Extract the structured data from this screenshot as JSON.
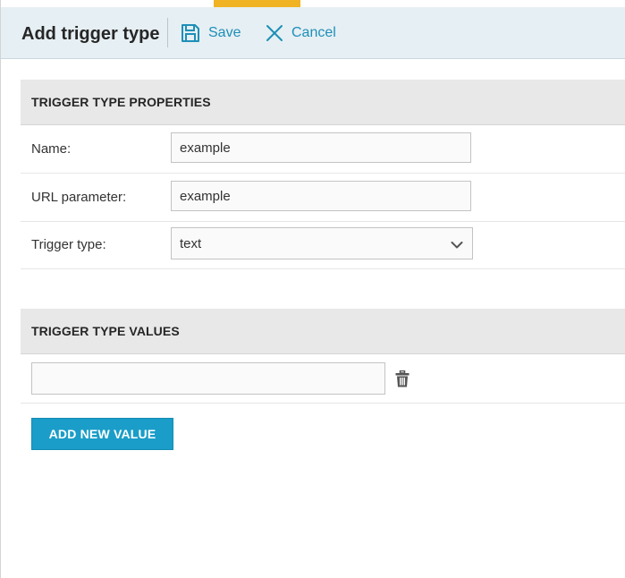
{
  "header": {
    "title": "Add trigger type",
    "save_label": "Save",
    "cancel_label": "Cancel"
  },
  "properties": {
    "section_title": "TRIGGER TYPE PROPERTIES",
    "name": {
      "label": "Name:",
      "value": "example"
    },
    "url_parameter": {
      "label": "URL parameter:",
      "value": "example"
    },
    "trigger_type": {
      "label": "Trigger type:",
      "selected": "text"
    }
  },
  "values": {
    "section_title": "TRIGGER TYPE VALUES",
    "items": [
      {
        "value": ""
      }
    ],
    "add_label": "ADD NEW VALUE"
  },
  "icons": {
    "save": "save-icon",
    "cancel": "close-icon",
    "dropdown": "chevron-down-icon",
    "delete": "trash-icon"
  },
  "colors": {
    "accent": "#1a9dc8",
    "tab_indicator": "#f0b323",
    "header_bg": "#e6eff3",
    "section_bg": "#e8e8e8"
  }
}
